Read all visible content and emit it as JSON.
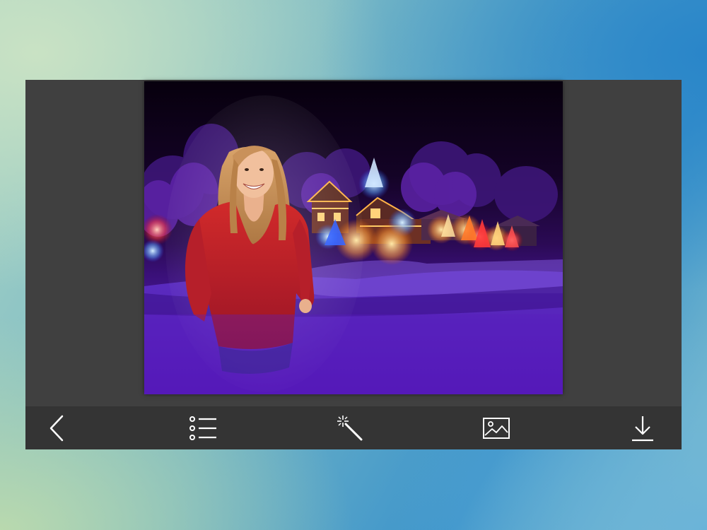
{
  "screen": {
    "background": "blurred-teal-blue-gradient"
  },
  "editor": {
    "photo": {
      "description_icon": "photo-montage",
      "subject": "woman-in-red-sweater",
      "scene": "christmas-lights-village-night"
    }
  },
  "toolbar": {
    "accent_color": "#ffffff",
    "background_color": "#343434",
    "buttons": [
      {
        "name": "back",
        "icon": "chevron-left-icon"
      },
      {
        "name": "frames-list",
        "icon": "list-icon"
      },
      {
        "name": "effects",
        "icon": "magic-wand-icon"
      },
      {
        "name": "gallery",
        "icon": "image-icon"
      },
      {
        "name": "save",
        "icon": "download-icon"
      }
    ]
  }
}
